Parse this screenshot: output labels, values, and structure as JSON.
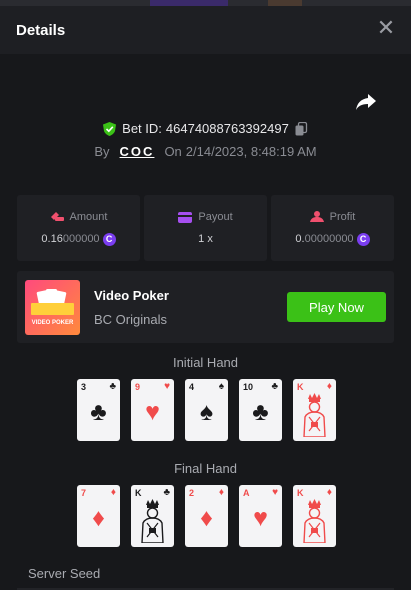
{
  "header": {
    "title": "Details"
  },
  "bet": {
    "id_label": "Bet ID:",
    "id_value": "46474088763392497",
    "by_label": "By",
    "user": "COC",
    "on_label": "On",
    "date": "2/14/2023, 8:48:19 AM"
  },
  "stats": {
    "amount": {
      "label": "Amount",
      "value_hi": "0.16",
      "value_lo": "000000",
      "coin": "C"
    },
    "payout": {
      "label": "Payout",
      "value": "1 x"
    },
    "profit": {
      "label": "Profit",
      "value_hi": "0.",
      "value_lo": "00000000",
      "coin": "C"
    }
  },
  "game": {
    "thumb_label": "VIDEO POKER",
    "name": "Video Poker",
    "provider": "BC Originals",
    "play_label": "Play Now"
  },
  "initial_hand": {
    "label": "Initial Hand",
    "cards": [
      {
        "rank": "3",
        "suit": "♣",
        "color": "#1b1b1d",
        "face": false
      },
      {
        "rank": "9",
        "suit": "♥",
        "color": "#f04b4b",
        "face": false
      },
      {
        "rank": "4",
        "suit": "♠",
        "color": "#1b1b1d",
        "face": false
      },
      {
        "rank": "10",
        "suit": "♣",
        "color": "#1b1b1d",
        "face": false
      },
      {
        "rank": "K",
        "suit": "♦",
        "color": "#f04b4b",
        "face": true
      }
    ]
  },
  "final_hand": {
    "label": "Final Hand",
    "cards": [
      {
        "rank": "7",
        "suit": "♦",
        "color": "#f04b4b",
        "face": false
      },
      {
        "rank": "K",
        "suit": "♣",
        "color": "#1b1b1d",
        "face": true
      },
      {
        "rank": "2",
        "suit": "♦",
        "color": "#f04b4b",
        "face": false
      },
      {
        "rank": "A",
        "suit": "♥",
        "color": "#f04b4b",
        "face": false
      },
      {
        "rank": "K",
        "suit": "♦",
        "color": "#f04b4b",
        "face": true
      }
    ]
  },
  "seed": {
    "label": "Server Seed"
  },
  "colors": {
    "accent_green": "#3bc117",
    "coin_purple": "#7a3df0",
    "suit_red": "#f04b4b"
  }
}
